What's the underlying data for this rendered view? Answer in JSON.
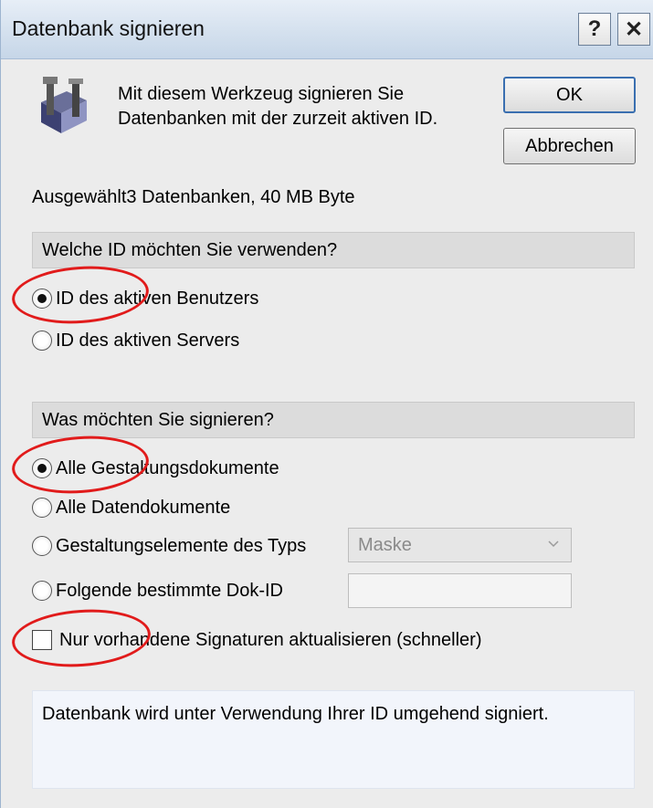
{
  "window": {
    "title": "Datenbank signieren",
    "help_label": "?",
    "close_label": "✕"
  },
  "intro": {
    "text": "Mit diesem Werkzeug signieren Sie Datenbanken mit der zurzeit aktiven ID.",
    "icon": "database-tool-icon"
  },
  "buttons": {
    "ok": "OK",
    "cancel": "Abbrechen"
  },
  "selection_info": "Ausgewählt3 Datenbanken, 40 MB Byte",
  "id_section": {
    "header": "Welche ID möchten Sie verwenden?",
    "options": [
      {
        "label": "ID des aktiven Benutzers",
        "checked": true
      },
      {
        "label": "ID des aktiven Servers",
        "checked": false
      }
    ]
  },
  "sign_section": {
    "header": "Was möchten Sie signieren?",
    "options": [
      {
        "label": "Alle Gestaltungsdokumente",
        "checked": true
      },
      {
        "label": "Alle Datendokumente",
        "checked": false
      },
      {
        "label": "Gestaltungselemente des Typs",
        "checked": false
      },
      {
        "label": "Folgende bestimmte Dok-ID",
        "checked": false
      }
    ],
    "type_select_value": "Maske",
    "doc_id_value": ""
  },
  "update_only": {
    "label": "Nur vorhandene Signaturen aktualisieren (schneller)",
    "checked": false
  },
  "info_text": "Datenbank wird unter Verwendung Ihrer ID umgehend signiert.",
  "colors": {
    "annotation": "#e11b1b",
    "titlebar": "#d6e2ef"
  }
}
